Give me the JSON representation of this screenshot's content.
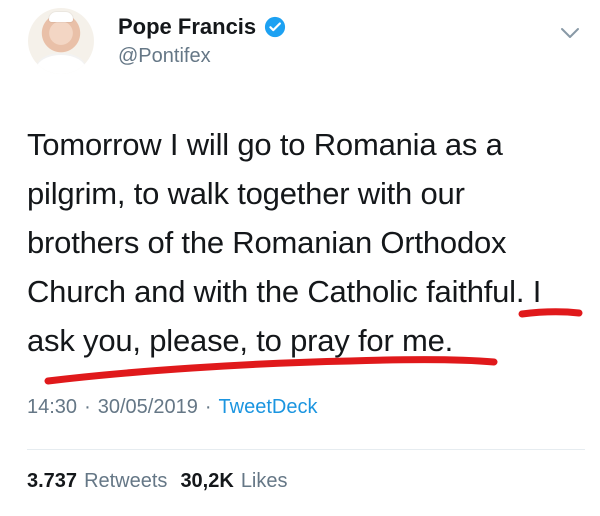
{
  "author": {
    "display_name": "Pope Francis",
    "handle": "@Pontifex",
    "verified": true,
    "avatar_icon": "profile-photo"
  },
  "tweet": {
    "text": "Tomorrow I will go to Romania as a pilgrim, to walk together with our brothers of the Romanian Orthodox Church and with the Catholic faithful. I ask you, please, to pray for me.",
    "lines": [
      "Tomorrow I will go to Romania as a",
      "pilgrim, to walk together with our",
      "brothers of the Romanian Orthodox",
      "Church and with the Catholic faithful. I",
      "ask you, please, to pray for me."
    ]
  },
  "meta": {
    "time": "14:30",
    "separator1": "·",
    "date": "30/05/2019",
    "separator2": "·",
    "source": "TweetDeck"
  },
  "stats": {
    "retweets_value": "3.737",
    "retweets_label": "Retweets",
    "likes_value": "30,2K",
    "likes_label": "Likes"
  },
  "colors": {
    "verified_badge": "#1da1f2",
    "link": "#1b95e0",
    "secondary_text": "#657786",
    "annotation_underline": "#e0191b"
  }
}
